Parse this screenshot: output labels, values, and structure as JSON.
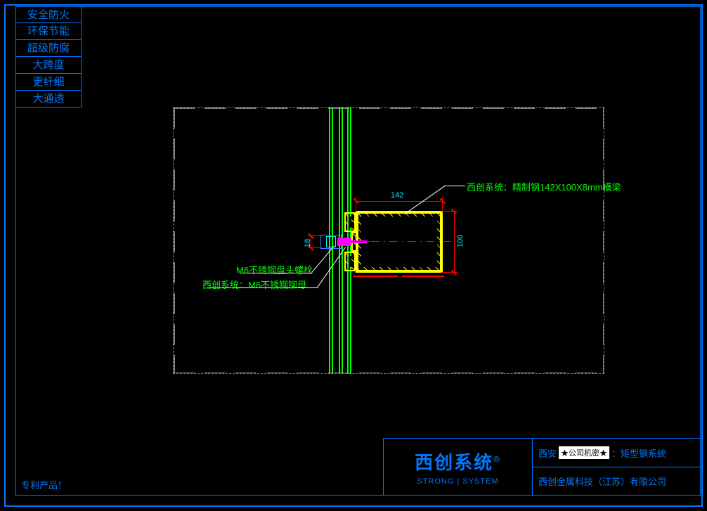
{
  "side_labels": [
    "安全防火",
    "环保节能",
    "超级防腐",
    "大跨度",
    "更纤细",
    "大通透"
  ],
  "patent_text": "专利产品！",
  "title_block": {
    "logo_main": "西创系统",
    "logo_reg": "®",
    "logo_sub": "STRONG | SYSTEM",
    "top_prefix": "西安",
    "secret_label": "★公司机密★",
    "top_suffix": "：矩型钢系统",
    "bottom": "西创金属科技（江苏）有限公司"
  },
  "dimensions": {
    "width_142": "142",
    "height_100": "100",
    "small_18": "18"
  },
  "annotations": {
    "beam": "西创系统：精制钢142X100X8mm横梁",
    "bolt": "M6不锈钢盘头螺栓",
    "nut": "西创系统：M6不锈钢铆母"
  }
}
